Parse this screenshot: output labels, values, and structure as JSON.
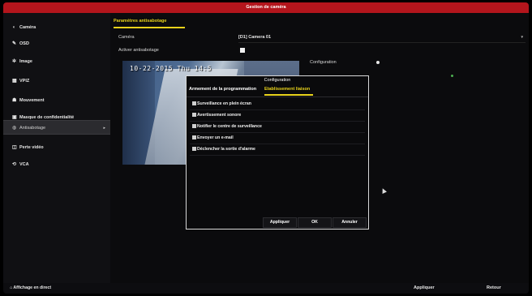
{
  "window": {
    "title": "Gestion de caméra"
  },
  "sidebar": {
    "items": [
      {
        "icon": "camera-icon",
        "glyph": "◖",
        "label": "Caméra"
      },
      {
        "icon": "osd-icon",
        "glyph": "✎",
        "label": "OSD"
      },
      {
        "icon": "image-icon",
        "glyph": "✲",
        "label": "Image"
      },
      {
        "icon": "vpiz-icon",
        "glyph": "▦",
        "label": "VPIZ"
      },
      {
        "icon": "motion-icon",
        "glyph": "☗",
        "label": "Mouvement"
      },
      {
        "icon": "privacy-mask-icon",
        "glyph": "▣",
        "label": "Masque de confidentialité"
      },
      {
        "icon": "tamper-icon",
        "glyph": "◍",
        "label": "Antisabotage",
        "active": true
      },
      {
        "icon": "video-loss-icon",
        "glyph": "◫",
        "label": "Perte vidéo"
      },
      {
        "icon": "vca-icon",
        "glyph": "⟲",
        "label": "VCA"
      }
    ]
  },
  "main": {
    "tab": "Paramètres antisabotage",
    "camera_label": "Caméra",
    "camera_value": "[D1] Camera 01",
    "enable_label": "Activer antisabotage",
    "preview_timestamp": "10-22-2015 Thu 14:5",
    "config_label": "Configuration"
  },
  "modal": {
    "title": "Configuration",
    "tabs": [
      "Armement de la programmation",
      "Etablissement liaison"
    ],
    "options": [
      "Surveillance en plein écran",
      "Avertissement sonore",
      "Notifier le centre de surveillance",
      "Envoyer un e-mail",
      "Déclencher la sortie d'alarme"
    ],
    "buttons": {
      "apply": "Appliquer",
      "ok": "OK",
      "cancel": "Annuler"
    }
  },
  "footer": {
    "live_view": "Affichage en direct",
    "apply": "Appliquer",
    "back": "Retour"
  },
  "colors": {
    "title_bar": "#b3151c",
    "accent": "#e8d21b"
  }
}
